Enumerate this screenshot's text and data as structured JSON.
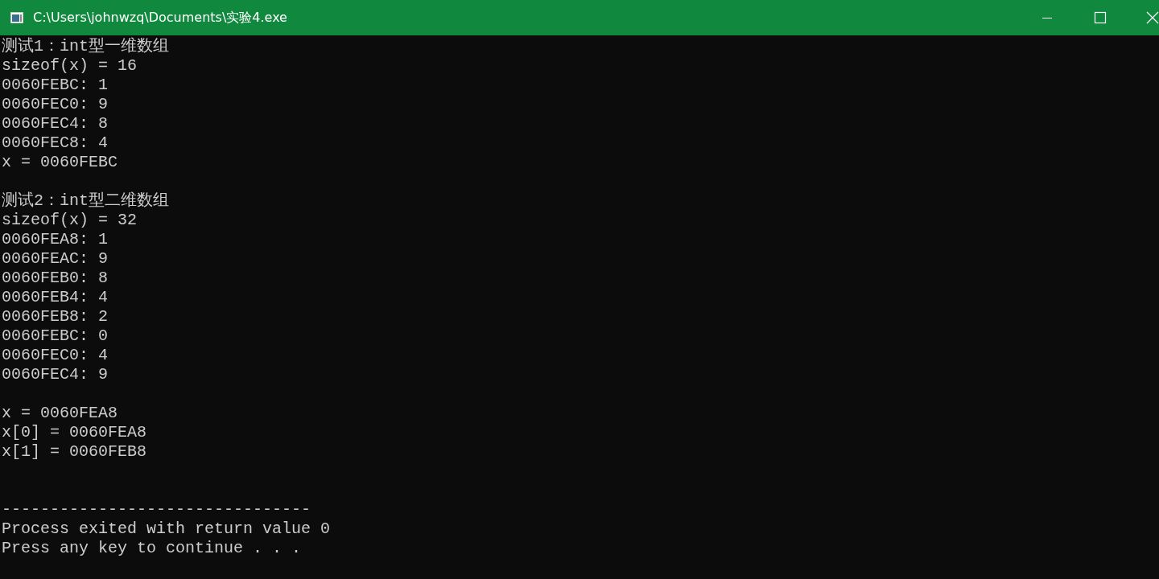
{
  "window": {
    "title": "C:\\Users\\johnwzq\\Documents\\实验4.exe"
  },
  "console": {
    "blocks": [
      {
        "kind": "output",
        "lines": [
          "测试1：int型一维数组",
          "sizeof(x) = 16",
          "0060FEBC: 1",
          "0060FEC0: 9",
          "0060FEC4: 8",
          "0060FEC8: 4",
          "x = 0060FEBC"
        ]
      },
      {
        "kind": "output",
        "lines": [
          "测试2：int型二维数组",
          "sizeof(x) = 32",
          "0060FEA8: 1",
          "0060FEAC: 9",
          "0060FEB0: 8",
          "0060FEB4: 4",
          "0060FEB8: 2",
          "0060FEBC: 0",
          "0060FEC0: 4",
          "0060FEC4: 9"
        ]
      },
      {
        "kind": "output",
        "lines": [
          "x = 0060FEA8",
          "x[0] = 0060FEA8",
          "x[1] = 0060FEB8"
        ]
      },
      {
        "kind": "footer",
        "lines": [
          "--------------------------------",
          "Process exited with return value 0",
          "Press any key to continue . . ."
        ]
      }
    ]
  }
}
